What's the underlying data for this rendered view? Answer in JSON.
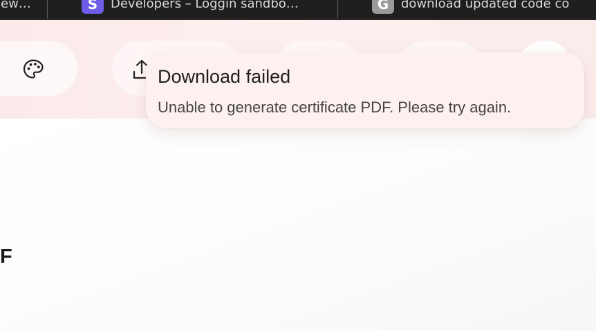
{
  "browser": {
    "tabs": [
      {
        "title": "lew…",
        "favicon": ""
      },
      {
        "title": "Developers – Loggin sandbo…",
        "favicon": "S",
        "favicon_color": "#6c5ce7"
      },
      {
        "title": "download updated code co",
        "favicon": "G",
        "favicon_color": "#9a9a9a"
      }
    ]
  },
  "header": {
    "icons": [
      "palette-icon",
      "share-upload-icon"
    ],
    "background": "#fbeaea"
  },
  "toast": {
    "title": "Download failed",
    "message": "Unable to generate certificate PDF. Please try again.",
    "background": "#fdf0f0"
  },
  "content": {
    "partial_text": "F"
  }
}
